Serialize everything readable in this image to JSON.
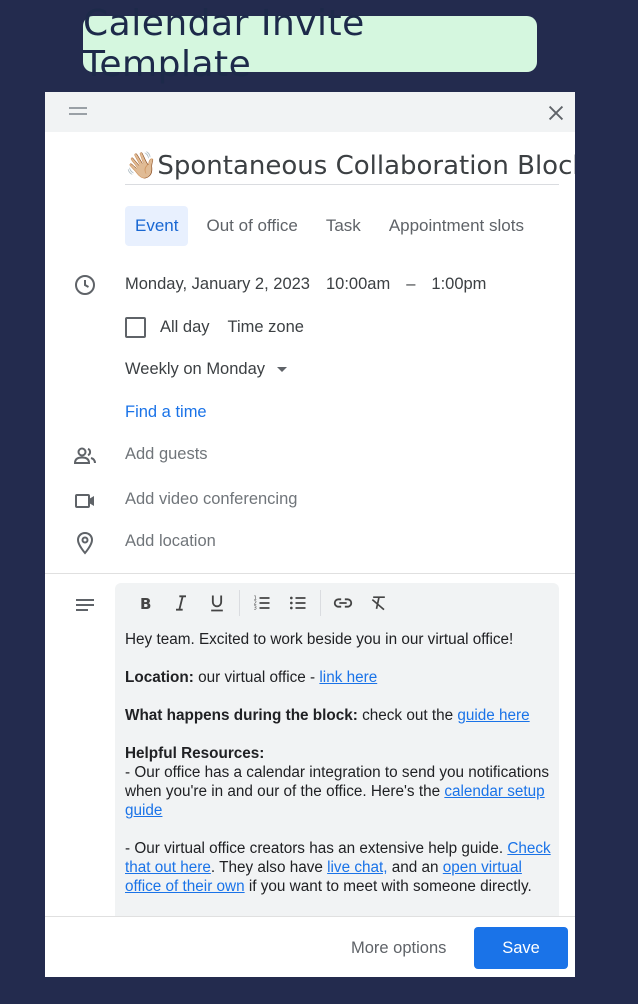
{
  "banner": {
    "text": "Calendar Invite Template"
  },
  "event": {
    "title_emoji": "👋🏼",
    "title": "Spontaneous Collaboration Block"
  },
  "tabs": [
    {
      "label": "Event",
      "active": true
    },
    {
      "label": "Out of office",
      "active": false
    },
    {
      "label": "Task",
      "active": false
    },
    {
      "label": "Appointment slots",
      "active": false
    }
  ],
  "datetime": {
    "date": "Monday, January 2, 2023",
    "start": "10:00am",
    "dash": "–",
    "end": "1:00pm"
  },
  "options": {
    "all_day": "All day",
    "time_zone": "Time zone",
    "recurrence": "Weekly on Monday",
    "find_time": "Find a time"
  },
  "fields": {
    "guests": "Add guests",
    "video": "Add video conferencing",
    "location": "Add location"
  },
  "description": {
    "line1": "Hey team. Excited to work beside you in our virtual office!",
    "loc_label": "Location:",
    "loc_text": " our virtual office - ",
    "loc_link": "link here",
    "what_label": "What happens during the block:",
    "what_text": " check out the ",
    "what_link": "guide here",
    "resources_label": "Helpful Resources:",
    "res1_text": "- Our office has a calendar integration to send you notifications when you're in and our of the office. Here's the ",
    "res1_link": "calendar setup guide",
    "res2_text": "- Our virtual office creators has an extensive help guide. ",
    "res2_link1": "Check that out here",
    "res2_mid": ". They also have ",
    "res2_link2": "live chat,",
    "res2_and": " and an ",
    "res2_link3": "open virtual office of their own",
    "res2_end": " if you want to meet with someone directly."
  },
  "footer": {
    "more_options": "More options",
    "save": "Save"
  },
  "colors": {
    "background": "#232b4e",
    "banner": "#d5f7df",
    "accent": "#1a73e8",
    "active_tab_bg": "#e8f0fe"
  }
}
